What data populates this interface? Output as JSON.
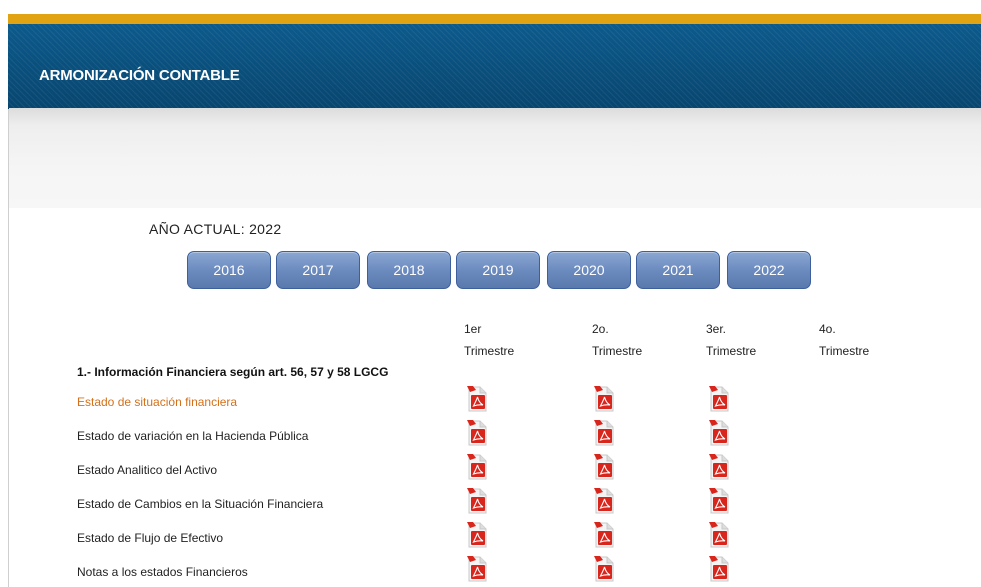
{
  "header": {
    "title": "ARMONIZACIÓN CONTABLE"
  },
  "colors": {
    "accent_stripe": "#e2a312",
    "banner_blue": "#0a5280",
    "year_button": "#6c8bbf",
    "active_link": "#d4701a",
    "pdf_red": "#d9261c"
  },
  "year_selector": {
    "current_label": "AÑO ACTUAL: 2022",
    "years": [
      "2016",
      "2017",
      "2018",
      "2019",
      "2020",
      "2021",
      "2022"
    ]
  },
  "table": {
    "column_headers": [
      {
        "line1": "1er",
        "line2": "Trimestre"
      },
      {
        "line1": "2o.",
        "line2": "Trimestre"
      },
      {
        "line1": "3er.",
        "line2": "Trimestre"
      },
      {
        "line1": "4o.",
        "line2": "Trimestre"
      }
    ],
    "section_title": "1.- Información Financiera según art. 56, 57 y 58 LGCG",
    "rows": [
      {
        "label": "Estado de situación financiera",
        "active": true,
        "files": [
          true,
          true,
          true,
          false
        ]
      },
      {
        "label": "Estado de variación en la Hacienda Pública",
        "active": false,
        "files": [
          true,
          true,
          true,
          false
        ]
      },
      {
        "label": "Estado Analitico del Activo",
        "active": false,
        "files": [
          true,
          true,
          true,
          false
        ]
      },
      {
        "label": "Estado de Cambios en la Situación Financiera",
        "active": false,
        "files": [
          true,
          true,
          true,
          false
        ]
      },
      {
        "label": "Estado de Flujo de Efectivo",
        "active": false,
        "files": [
          true,
          true,
          true,
          false
        ]
      },
      {
        "label": "Notas a los estados Financieros",
        "active": false,
        "files": [
          true,
          true,
          true,
          false
        ]
      }
    ],
    "file_icon": "pdf-file-icon"
  }
}
